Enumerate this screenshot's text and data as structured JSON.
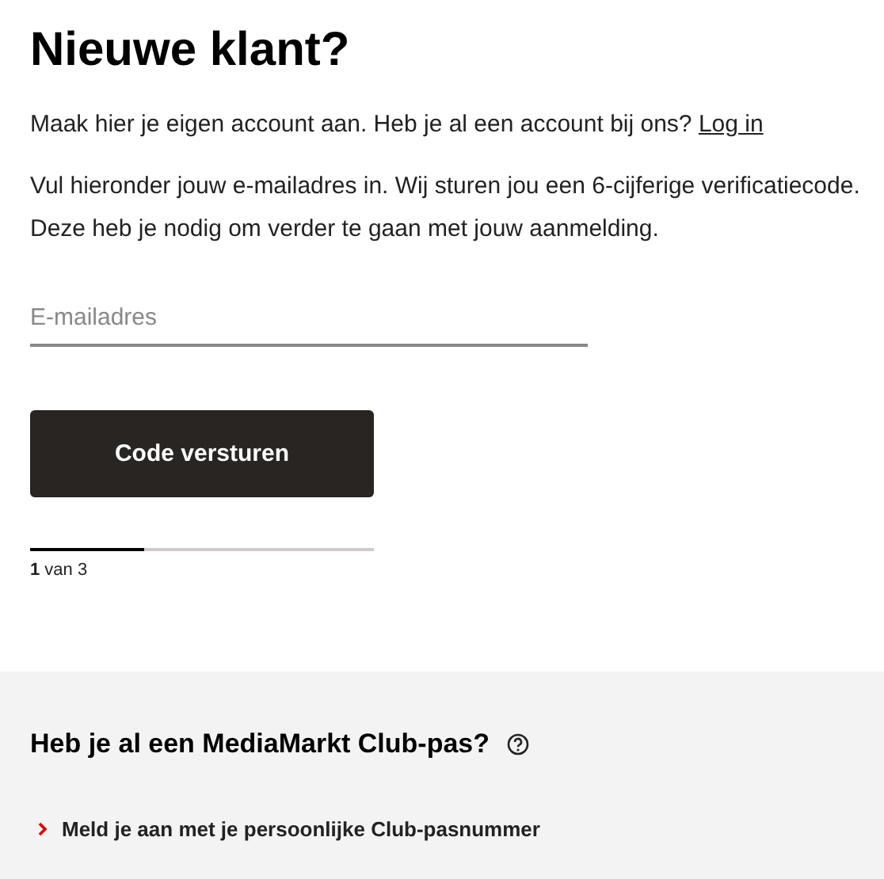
{
  "title": "Nieuwe klant?",
  "intro": {
    "text": "Maak hier je eigen account aan. Heb je al een account bij ons?",
    "link": "Log in"
  },
  "instruction": "Vul hieronder jouw e-mailadres in. Wij sturen jou een 6-cijferige verificatiecode. Deze heb je nodig om verder te gaan met jouw aanmelding.",
  "email_field": {
    "placeholder": "E-mailadres"
  },
  "submit_button": "Code versturen",
  "progress": {
    "level": 0.33,
    "label": "**1** van 3"
  },
  "club_section": {
    "heading": "Heb je al een MediaMarkt Club-pas?",
    "link": "Meld je aan met je persoonlijke Club-pasnummer"
  }
}
